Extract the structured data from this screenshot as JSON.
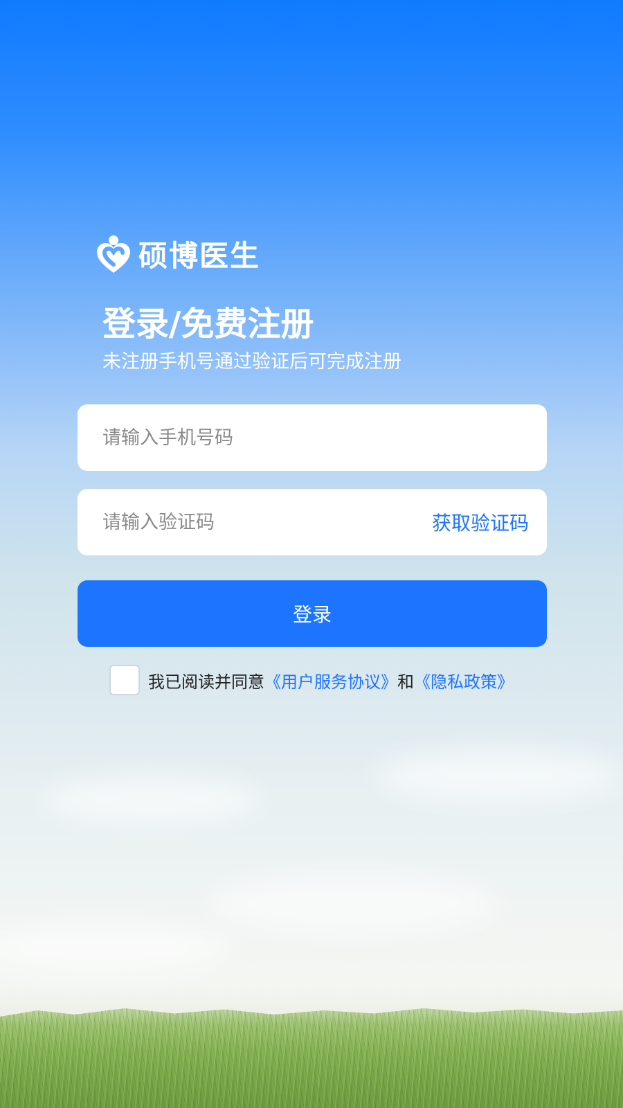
{
  "brand": {
    "name": "硕博医生",
    "icon": "heart-person-logo"
  },
  "header": {
    "title": "登录/免费注册",
    "subtitle": "未注册手机号通过验证后可完成注册"
  },
  "form": {
    "phone_placeholder": "请输入手机号码",
    "phone_value": "",
    "code_placeholder": "请输入验证码",
    "code_value": "",
    "get_code_label": "获取验证码",
    "login_label": "登录"
  },
  "agreement": {
    "checked": false,
    "prefix": "我已阅读并同意",
    "terms_link": "《用户服务协议》",
    "conjunction": "和",
    "privacy_link": "《隐私政策》"
  },
  "colors": {
    "accent": "#1c74ff",
    "sky_top": "#0f7bff",
    "text_on_sky": "#ffffff"
  }
}
